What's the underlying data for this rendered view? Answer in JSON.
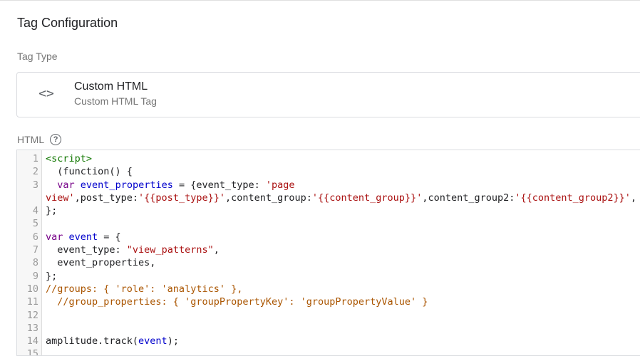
{
  "panel": {
    "title": "Tag Configuration",
    "tag_type_label": "Tag Type",
    "tag_type": {
      "icon": "code-icon",
      "name": "Custom HTML",
      "description": "Custom HTML Tag"
    },
    "html_label": "HTML",
    "help_icon": "help-icon"
  },
  "editor": {
    "lines": [
      {
        "n": "1",
        "parts": [
          {
            "t": "<script>",
            "c": "tag"
          }
        ]
      },
      {
        "n": "2",
        "parts": [
          {
            "t": "  (function() {",
            "c": ""
          }
        ]
      },
      {
        "n": "3",
        "parts": [
          {
            "t": "  ",
            "c": ""
          },
          {
            "t": "var",
            "c": "kw"
          },
          {
            "t": " ",
            "c": ""
          },
          {
            "t": "event_properties",
            "c": "var"
          },
          {
            "t": " = {event_type: ",
            "c": ""
          },
          {
            "t": "'page",
            "c": "str"
          }
        ]
      },
      {
        "n": "",
        "parts": [
          {
            "t": "view'",
            "c": "str"
          },
          {
            "t": ",post_type:",
            "c": ""
          },
          {
            "t": "'{{post_type}}'",
            "c": "str"
          },
          {
            "t": ",content_group:",
            "c": ""
          },
          {
            "t": "'{{content_group}}'",
            "c": "str"
          },
          {
            "t": ",content_group2:",
            "c": ""
          },
          {
            "t": "'{{content_group2}}'",
            "c": "str"
          },
          {
            "t": ",",
            "c": ""
          }
        ]
      },
      {
        "n": "4",
        "parts": [
          {
            "t": "};",
            "c": ""
          }
        ]
      },
      {
        "n": "5",
        "parts": [
          {
            "t": "",
            "c": ""
          }
        ]
      },
      {
        "n": "6",
        "parts": [
          {
            "t": "var",
            "c": "kw"
          },
          {
            "t": " ",
            "c": ""
          },
          {
            "t": "event",
            "c": "var"
          },
          {
            "t": " = {",
            "c": ""
          }
        ]
      },
      {
        "n": "7",
        "parts": [
          {
            "t": "  event_type: ",
            "c": ""
          },
          {
            "t": "\"view_patterns\"",
            "c": "str"
          },
          {
            "t": ",",
            "c": ""
          }
        ]
      },
      {
        "n": "8",
        "parts": [
          {
            "t": "  event_properties,",
            "c": ""
          }
        ]
      },
      {
        "n": "9",
        "parts": [
          {
            "t": "};",
            "c": ""
          }
        ]
      },
      {
        "n": "10",
        "parts": [
          {
            "t": "//groups: { 'role': 'analytics' },",
            "c": "cm"
          }
        ]
      },
      {
        "n": "11",
        "parts": [
          {
            "t": "  //group_properties: { 'groupPropertyKey': 'groupPropertyValue' }",
            "c": "cm"
          }
        ]
      },
      {
        "n": "12",
        "parts": [
          {
            "t": "",
            "c": ""
          }
        ]
      },
      {
        "n": "13",
        "parts": [
          {
            "t": "",
            "c": ""
          }
        ]
      },
      {
        "n": "14",
        "parts": [
          {
            "t": "amplitude.track(",
            "c": ""
          },
          {
            "t": "event",
            "c": "var"
          },
          {
            "t": ");",
            "c": ""
          }
        ]
      },
      {
        "n": "15",
        "parts": [
          {
            "t": "",
            "c": ""
          }
        ]
      }
    ]
  }
}
